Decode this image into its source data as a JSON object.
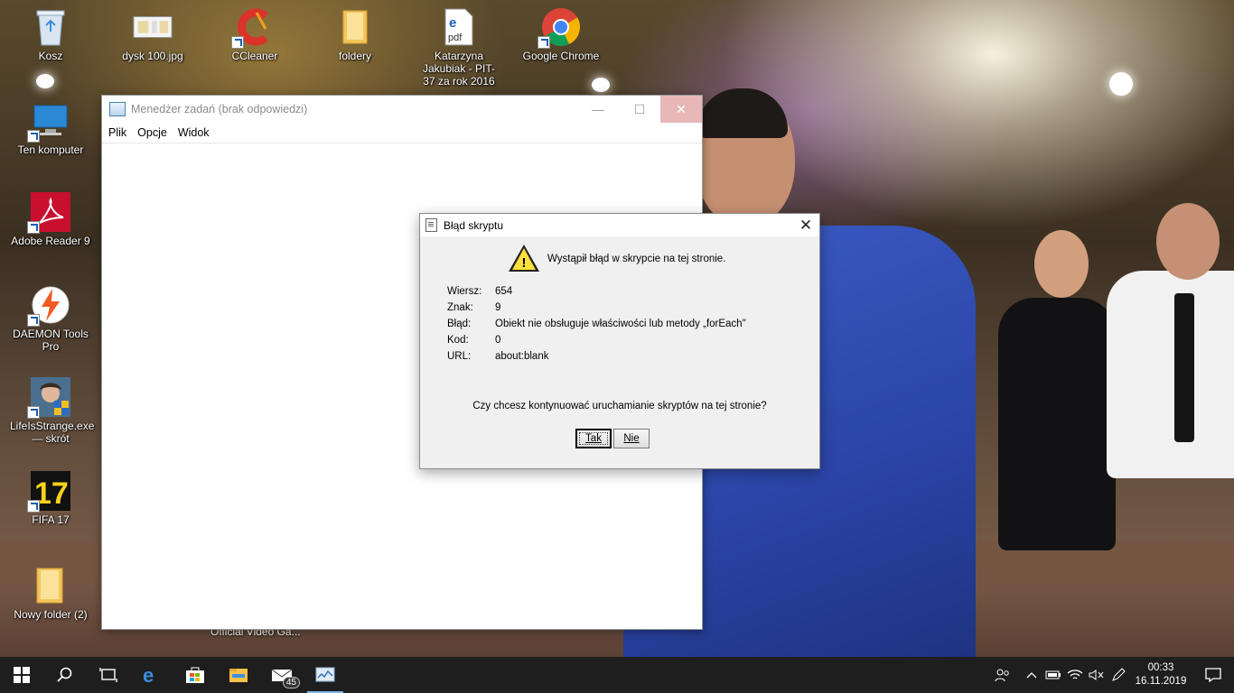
{
  "desktop": {
    "icons": [
      {
        "label": "Kosz"
      },
      {
        "label": "dysk 100.jpg"
      },
      {
        "label": "CCleaner"
      },
      {
        "label": "foldery"
      },
      {
        "label": "Katarzyna Jakubiak - PIT-37 za rok 2016 ..."
      },
      {
        "label": "Google Chrome"
      },
      {
        "label": "Ten komputer"
      },
      {
        "label": "Adobe Reader 9"
      },
      {
        "label": "DAEMON Tools Pro"
      },
      {
        "label": "LifeIsStrange.exe — skrót"
      },
      {
        "label": "FIFA 17"
      },
      {
        "label": "Nowy folder (2)"
      }
    ],
    "behind_label": "Official Video Ga..."
  },
  "task_manager": {
    "title": "Menedżer zadań (brak odpowiedzi)",
    "menu": [
      "Plik",
      "Opcje",
      "Widok"
    ],
    "minimize": "—",
    "maximize": "☐",
    "close": "✕"
  },
  "dialog": {
    "title": "Błąd skryptu",
    "message": "Wystąpił błąd w skrypcie na tej stronie.",
    "rows": [
      {
        "key": "Wiersz:",
        "value": "654"
      },
      {
        "key": "Znak:",
        "value": "9"
      },
      {
        "key": "Błąd:",
        "value": "Obiekt nie obsługuje właściwości lub metody „forEach\""
      },
      {
        "key": "Kod:",
        "value": "0"
      },
      {
        "key": "URL:",
        "value": "about:blank"
      }
    ],
    "question": "Czy chcesz kontynuować uruchamianie skryptów na tej stronie?",
    "yes_label": "Tak",
    "no_label": "Nie",
    "close": "✕"
  },
  "taskbar": {
    "mail_badge": "45",
    "clock_time": "00:33",
    "clock_date": "16.11.2019",
    "accent": "#7fb5e6"
  }
}
